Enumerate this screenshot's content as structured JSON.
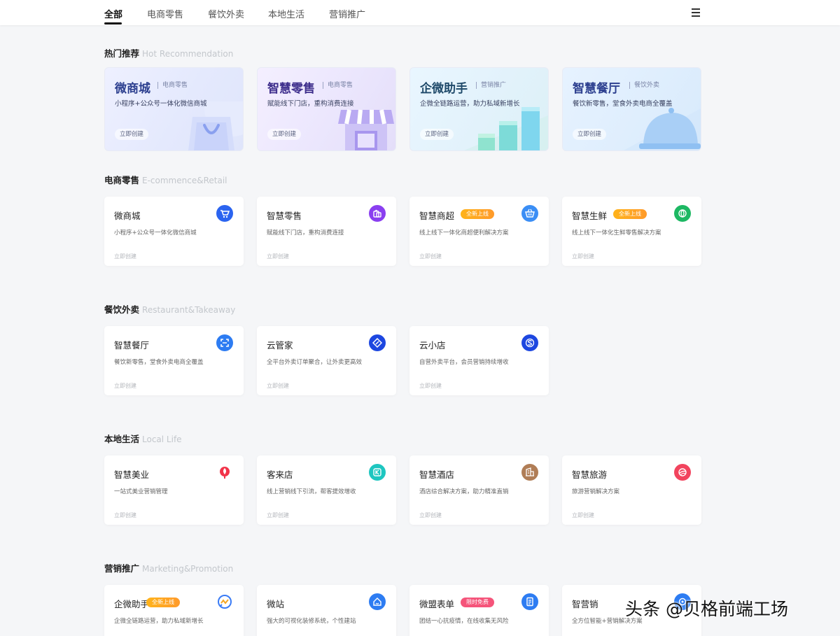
{
  "nav": {
    "tabs": [
      {
        "label": "全部",
        "active": true
      },
      {
        "label": "电商零售"
      },
      {
        "label": "餐饮外卖"
      },
      {
        "label": "本地生活"
      },
      {
        "label": "营销推广"
      }
    ],
    "menu_icon": "menu-icon"
  },
  "hot": {
    "title": "热门推荐",
    "title_en": "Hot Recommendation",
    "cards": [
      {
        "title": "微商城",
        "category": "电商零售",
        "desc": "小程序+公众号一体化微信商城",
        "action": "立即创建",
        "art": "shopping-bag-illustration"
      },
      {
        "title": "智慧零售",
        "category": "电商零售",
        "desc": "赋能线下门店，重构消费连接",
        "action": "立即创建",
        "art": "storefront-illustration"
      },
      {
        "title": "企微助手",
        "category": "营销推广",
        "desc": "企微全链路运营，助力私域新增长",
        "action": "立即创建",
        "art": "growth-bars-illustration"
      },
      {
        "title": "智慧餐厅",
        "category": "餐饮外卖",
        "desc": "餐饮新零售，堂食外卖电商全覆盖",
        "action": "立即创建",
        "art": "food-cloche-illustration"
      }
    ]
  },
  "sections": [
    {
      "title": "电商零售",
      "title_en": "E-commence&Retail",
      "cards": [
        {
          "title": "微商城",
          "desc": "小程序+公众号一体化微信商城",
          "action": "立即创建",
          "icon": "shopping-cart-icon",
          "color": "#2b64f0"
        },
        {
          "title": "智慧零售",
          "desc": "赋能线下门店，重构消费连接",
          "action": "立即创建",
          "icon": "shopping-bags-icon",
          "color": "#8a3ff0"
        },
        {
          "title": "智慧商超",
          "badge": "全新上线",
          "desc": "线上线下一体化商超便利解决方案",
          "action": "立即创建",
          "icon": "basket-icon",
          "color": "#3b8ef5"
        },
        {
          "title": "智慧生鲜",
          "badge": "全新上线",
          "desc": "线上线下一体化生鲜零售解决方案",
          "action": "立即创建",
          "icon": "leaf-icon",
          "color": "#1db863"
        }
      ]
    },
    {
      "title": "餐饮外卖",
      "title_en": "Restaurant&Takeaway",
      "cards": [
        {
          "title": "智慧餐厅",
          "desc": "餐饮新零售，堂食外卖电商全覆盖",
          "action": "立即创建",
          "icon": "scan-frame-icon",
          "color": "#2d7cf2"
        },
        {
          "title": "云管家",
          "desc": "全平台外卖订单聚合，让外卖更高效",
          "action": "立即创建",
          "icon": "diamond-link-icon",
          "color": "#1d47e0"
        },
        {
          "title": "云小店",
          "desc": "自营外卖平台，会员营销持续增收",
          "action": "立即创建",
          "icon": "s-shape-icon",
          "color": "#1d47e0"
        }
      ]
    },
    {
      "title": "本地生活",
      "title_en": "Local Life",
      "cards": [
        {
          "title": "智慧美业",
          "desc": "一站式美业营销管理",
          "action": "立即创建",
          "icon": "beauty-icon",
          "color": "#f2344a"
        },
        {
          "title": "客来店",
          "desc": "线上营销线下引流，帮客提效增收",
          "action": "立即创建",
          "icon": "store-k-icon",
          "color": "#1ec6c0"
        },
        {
          "title": "智慧酒店",
          "desc": "酒店综合解决方案，助力精准直销",
          "action": "立即创建",
          "icon": "hotel-building-icon",
          "color": "#b07d56"
        },
        {
          "title": "智慧旅游",
          "desc": "旅游营销解决方案",
          "action": "立即创建",
          "icon": "travel-icon",
          "color": "#f2445e"
        }
      ]
    },
    {
      "title": "营销推广",
      "title_en": "Marketing&Promotion",
      "cards": [
        {
          "title": "企微助手",
          "badge": "全新上线",
          "desc": "企微全链路运营，助力私域新增长",
          "action": "",
          "icon": "chat-wave-icon",
          "color": "#3a7bf5"
        },
        {
          "title": "微站",
          "desc": "强大的可视化装修系统，个性建站",
          "action": "",
          "icon": "micro-site-icon",
          "color": "#2d7cf2"
        },
        {
          "title": "微盟表单",
          "badge": "限时免费",
          "badge_style": "red",
          "desc": "团结一心抗疫情，在线收集无风险",
          "action": "",
          "icon": "form-icon",
          "color": "#2d7cf2"
        },
        {
          "title": "智营销",
          "desc": "全方位智能+营销解决方案",
          "action": "",
          "icon": "smart-marketing-icon",
          "color": "#2d7cf2"
        }
      ]
    }
  ],
  "watermark": "头条 @贝格前端工场"
}
